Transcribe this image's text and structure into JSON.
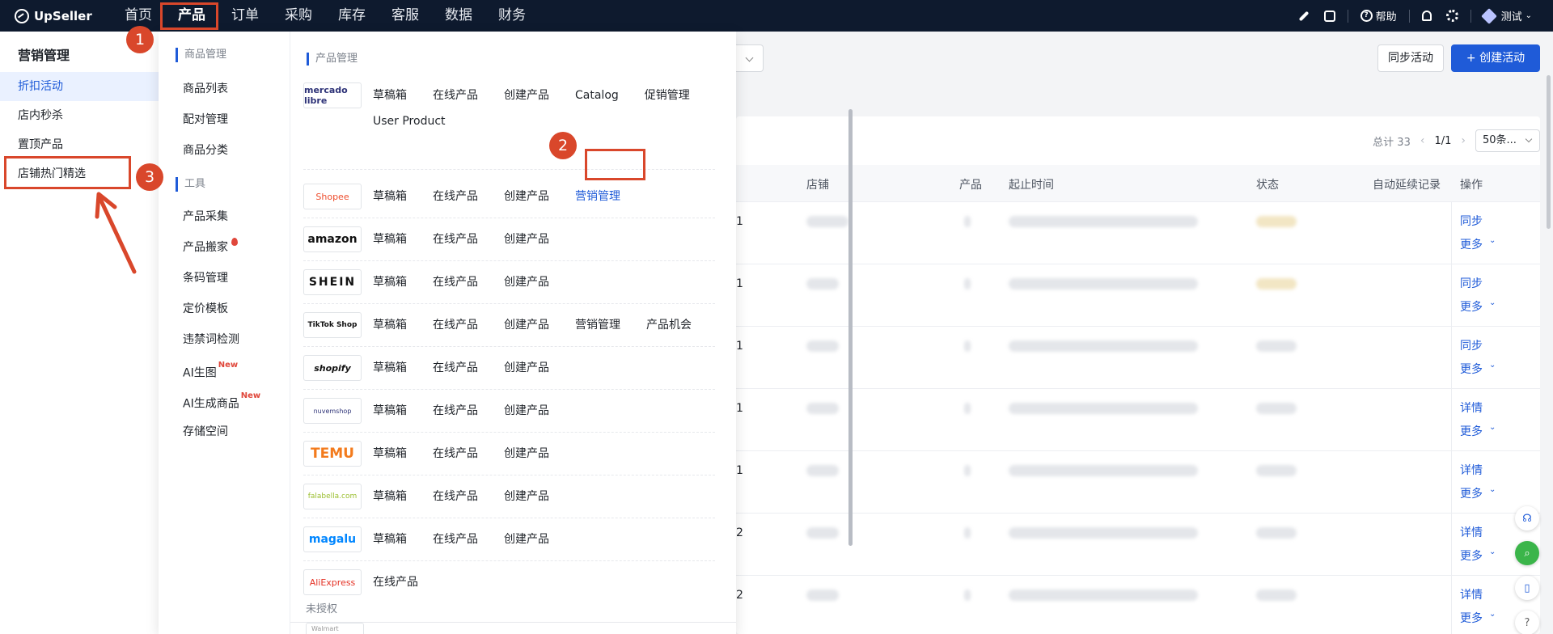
{
  "topbar": {
    "brand": "UpSeller",
    "nav": [
      "首页",
      "产品",
      "订单",
      "采购",
      "库存",
      "客服",
      "数据",
      "财务"
    ],
    "help": "帮助",
    "user": "测试"
  },
  "sidebar": {
    "title": "营销管理",
    "items": [
      "折扣活动",
      "店内秒杀",
      "置顶产品",
      "店铺热门精选"
    ]
  },
  "menu": {
    "col1": {
      "group1_title": "商品管理",
      "group1_items": [
        "商品列表",
        "配对管理",
        "商品分类"
      ],
      "group2_title": "工具",
      "group2_items": [
        "产品采集",
        "产品搬家",
        "条码管理",
        "定价模板",
        "违禁词检测",
        "AI生图",
        "AI生成商品",
        "存储空间"
      ],
      "new_badge": "New"
    },
    "col2": {
      "title": "产品管理",
      "platforms": [
        {
          "logo": "mercado libre",
          "links": [
            "草稿箱",
            "在线产品",
            "创建产品",
            "Catalog",
            "促销管理",
            "User Product"
          ]
        },
        {
          "logo": "Shopee",
          "links": [
            "草稿箱",
            "在线产品",
            "创建产品",
            "营销管理"
          ]
        },
        {
          "logo": "amazon",
          "links": [
            "草稿箱",
            "在线产品",
            "创建产品"
          ]
        },
        {
          "logo": "SHEIN",
          "links": [
            "草稿箱",
            "在线产品",
            "创建产品"
          ]
        },
        {
          "logo": "TikTok Shop",
          "links": [
            "草稿箱",
            "在线产品",
            "创建产品",
            "营销管理",
            "产品机会"
          ]
        },
        {
          "logo": "shopify",
          "links": [
            "草稿箱",
            "在线产品",
            "创建产品"
          ]
        },
        {
          "logo": "nuvemshop",
          "links": [
            "草稿箱",
            "在线产品",
            "创建产品"
          ]
        },
        {
          "logo": "TEMU",
          "links": [
            "草稿箱",
            "在线产品",
            "创建产品"
          ]
        },
        {
          "logo": "falabella.com",
          "links": [
            "草稿箱",
            "在线产品",
            "创建产品"
          ]
        },
        {
          "logo": "magalu",
          "links": [
            "草稿箱",
            "在线产品",
            "创建产品"
          ]
        },
        {
          "logo": "AliExpress",
          "links": [
            "在线产品"
          ]
        }
      ],
      "unauthorized": "未授权",
      "walmart": "Walmart"
    }
  },
  "main": {
    "sync_btn": "同步活动",
    "create_btn": "+ 创建活动",
    "total": "总计 33",
    "page": "1/1",
    "page_size": "50条...",
    "columns": [
      "店铺",
      "产品",
      "起止时间",
      "状态",
      "自动延续记录",
      "操作"
    ],
    "rows": [
      {
        "num": "1",
        "op1": "同步",
        "op2": "更多"
      },
      {
        "num": "1",
        "op1": "同步",
        "op2": "更多"
      },
      {
        "num": "1",
        "op1": "同步",
        "op2": "更多"
      },
      {
        "num": "1",
        "op1": "详情",
        "op2": "更多"
      },
      {
        "num": "1",
        "op1": "详情",
        "op2": "更多"
      },
      {
        "num": "2",
        "op1": "详情",
        "op2": "更多"
      },
      {
        "num": "2",
        "op1": "详情",
        "op2": "更多"
      }
    ]
  },
  "annotations": [
    "1",
    "2",
    "3"
  ],
  "colors": {
    "accent": "#1f5bd8",
    "annotation": "#d9472b",
    "topbar": "#0e1a2e"
  }
}
